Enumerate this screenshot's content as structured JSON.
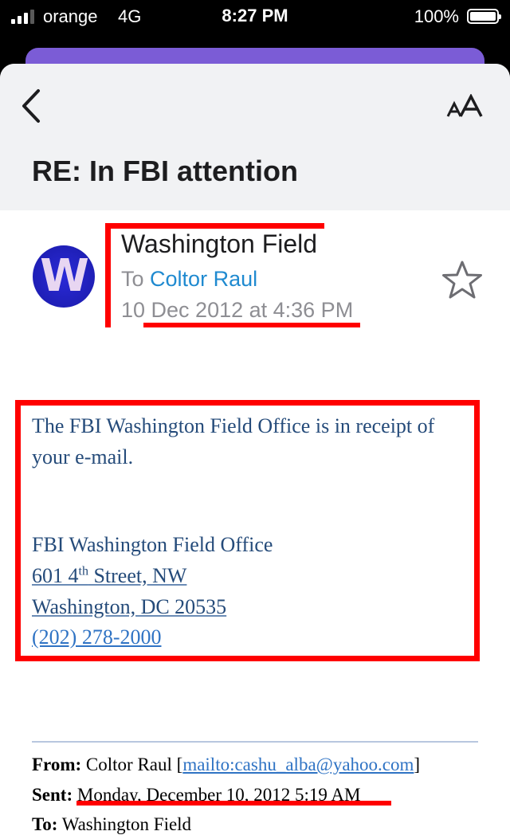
{
  "status_bar": {
    "carrier": "orange",
    "network": "4G",
    "time": "8:27 PM",
    "battery": "100%",
    "battery_level": 1.0
  },
  "header": {
    "subject": "RE: In FBI attention",
    "back_icon": "chevron-left-icon",
    "text_size_icon": "text-size-icon"
  },
  "message": {
    "avatar_letter": "W",
    "sender": "Washington Field",
    "to_label": "To",
    "to_name": "Coltor Raul",
    "date": "10 Dec 2012 at 4:36 PM",
    "star_icon": "star-outline-icon"
  },
  "body": {
    "line1": "The FBI Washington Field Office is in receipt of",
    "line2": "your e-mail.",
    "office": "FBI Washington Field Office",
    "street_num": "601 4",
    "street_sup": "th",
    "street_rest": " Street, NW",
    "city": "Washington, DC 20535",
    "phone": "(202) 278-2000"
  },
  "quoted": {
    "from_label": "From:",
    "from_name": " Coltor Raul [",
    "from_email": "mailto:cashu_alba@yahoo.com",
    "from_close": "]",
    "sent_label": "Sent:",
    "sent_value": " Monday, December 10, 2012 5:19 AM",
    "to_label": "To:",
    "to_value": " Washington Field"
  },
  "colors": {
    "accent": "#1f8ad0",
    "annotation": "#ff0000",
    "body_text": "#254b7a"
  }
}
